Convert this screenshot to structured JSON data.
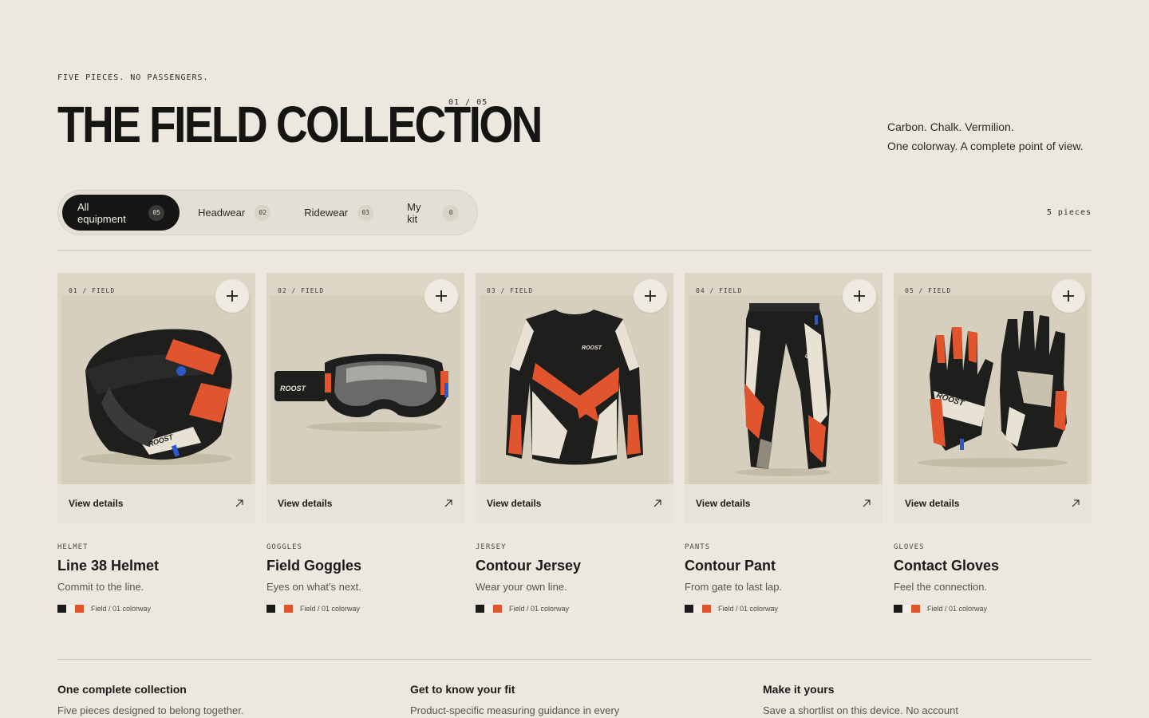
{
  "header": {
    "eyebrow": "FIVE PIECES. NO PASSENGERS.",
    "title": "THE FIELD COLLECTION",
    "counter": "01 / 05",
    "tagline_line1": "Carbon. Chalk. Vermilion.",
    "tagline_line2": "One colorway. A complete point of view."
  },
  "filters": [
    {
      "label": "All equipment",
      "count": "05",
      "active": true
    },
    {
      "label": "Headwear",
      "count": "02",
      "active": false
    },
    {
      "label": "Ridewear",
      "count": "03",
      "active": false
    },
    {
      "label": "My kit",
      "count": "0",
      "active": false
    }
  ],
  "pieces_count": "5 pieces",
  "colors": {
    "background": "#ece8df",
    "carbon": "#1b1b1a",
    "chalk": "#e8e2d4",
    "vermilion": "#e0552e",
    "blue_accent": "#2c59c8"
  },
  "products": [
    {
      "code": "01 / FIELD",
      "category": "HELMET",
      "name": "Line 38 Helmet",
      "description": "Commit to the line.",
      "details_label": "View details",
      "colorway": "Field / 01 colorway",
      "icon": "helmet-icon"
    },
    {
      "code": "02 / FIELD",
      "category": "GOGGLES",
      "name": "Field Goggles",
      "description": "Eyes on what's next.",
      "details_label": "View details",
      "colorway": "Field / 01 colorway",
      "icon": "goggles-icon"
    },
    {
      "code": "03 / FIELD",
      "category": "JERSEY",
      "name": "Contour Jersey",
      "description": "Wear your own line.",
      "details_label": "View details",
      "colorway": "Field / 01 colorway",
      "icon": "jersey-icon"
    },
    {
      "code": "04 / FIELD",
      "category": "PANTS",
      "name": "Contour Pant",
      "description": "From gate to last lap.",
      "details_label": "View details",
      "colorway": "Field / 01 colorway",
      "icon": "pants-icon"
    },
    {
      "code": "05 / FIELD",
      "category": "GLOVES",
      "name": "Contact Gloves",
      "description": "Feel the connection.",
      "details_label": "View details",
      "colorway": "Field / 01 colorway",
      "icon": "gloves-icon"
    }
  ],
  "product_brand": "ROOST",
  "features": [
    {
      "heading": "One complete collection",
      "body": "Five pieces designed to belong together."
    },
    {
      "heading": "Get to know your fit",
      "body": "Product-specific measuring guidance in every"
    },
    {
      "heading": "Make it yours",
      "body": "Save a shortlist on this device. No account"
    }
  ]
}
